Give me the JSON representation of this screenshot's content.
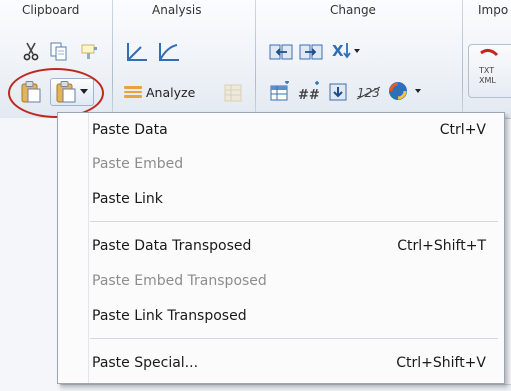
{
  "ribbon": {
    "groups": {
      "clipboard": "Clipboard",
      "analysis": "Analysis",
      "change": "Change",
      "import_partial": "Impo"
    },
    "analyze_label": "Analyze"
  },
  "menu": {
    "items": [
      {
        "label": "Paste Data",
        "shortcut": "Ctrl+V",
        "enabled": true
      },
      {
        "label": "Paste Embed",
        "shortcut": "",
        "enabled": false
      },
      {
        "label": "Paste Link",
        "shortcut": "",
        "enabled": true
      },
      {
        "label": "Paste Data Transposed",
        "shortcut": "Ctrl+Shift+T",
        "enabled": true
      },
      {
        "label": "Paste Embed Transposed",
        "shortcut": "",
        "enabled": false
      },
      {
        "label": "Paste Link Transposed",
        "shortcut": "",
        "enabled": true
      },
      {
        "label": "Paste Special...",
        "shortcut": "Ctrl+Shift+V",
        "enabled": true
      }
    ]
  },
  "colors": {
    "highlight_ring": "#c0281e",
    "accent_orange": "#e8a33a",
    "icon_blue": "#2f6fb8"
  }
}
